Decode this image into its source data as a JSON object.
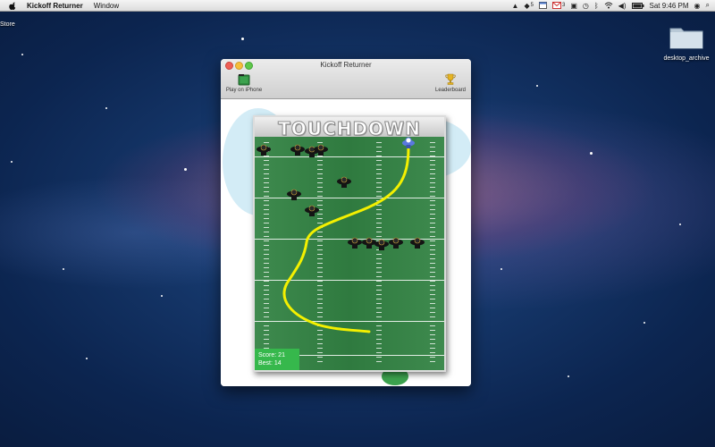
{
  "menubar": {
    "app_name": "Kickoff Returner",
    "menus": [
      "Window"
    ],
    "tray": {
      "notification_count": "5",
      "mail_count": "3",
      "clock": "Sat 9:46 PM"
    }
  },
  "desktop": {
    "store_label": "Store",
    "folder_label": "desktop_archive"
  },
  "window": {
    "title": "Kickoff Returner",
    "toolbar": {
      "left_label": "Play on iPhone",
      "right_label": "Leaderboard"
    }
  },
  "game": {
    "header_text": "TOUCHDOWN",
    "score_label": "Score: 21",
    "best_label": "Best: 14"
  },
  "colors": {
    "field_green": "#2f7a3f",
    "path_yellow": "#f4f000",
    "score_green": "#36b84c",
    "returner_blue": "#5a78e0",
    "defender_black": "#141414"
  }
}
